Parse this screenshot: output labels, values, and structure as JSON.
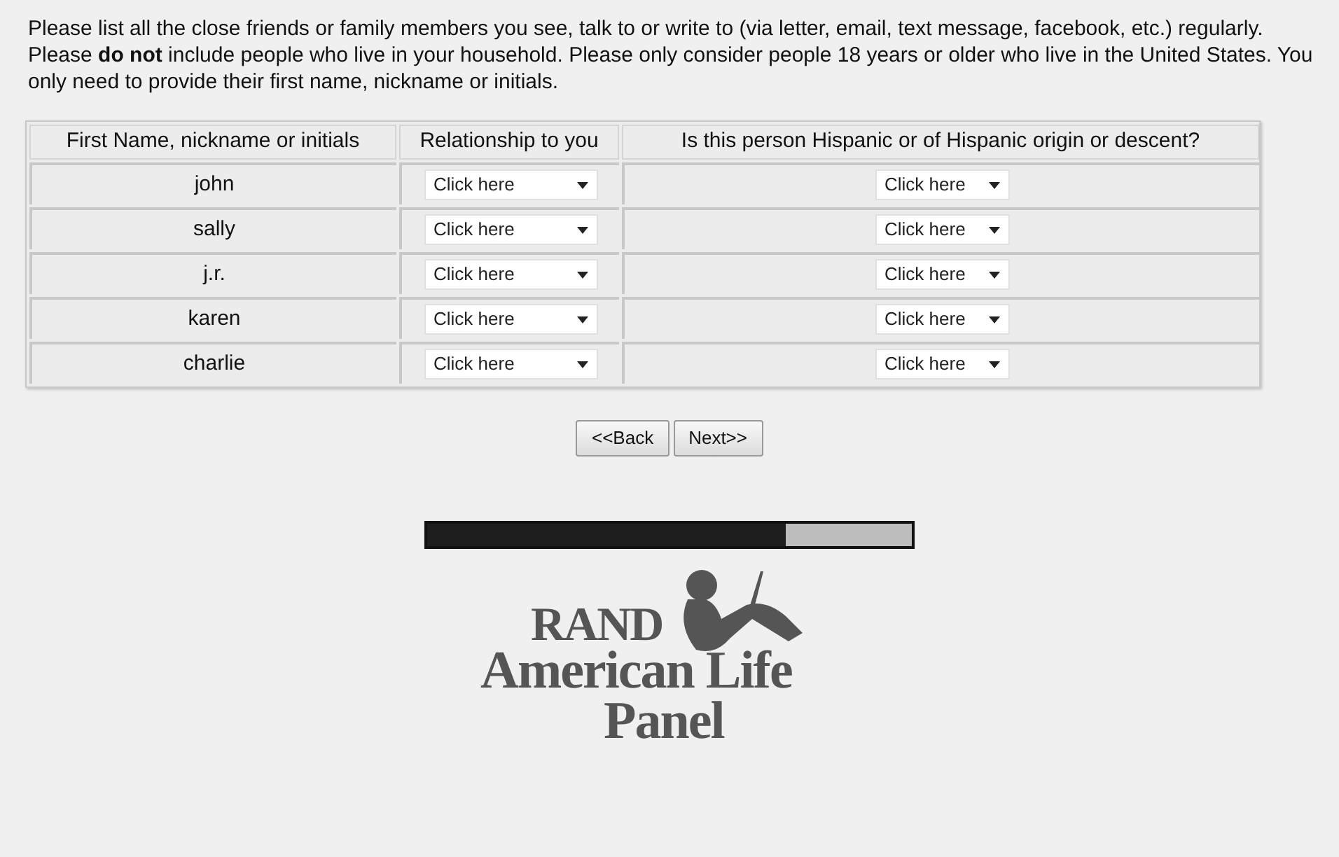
{
  "instructions": "Please list all the close friends or family members you see, talk to or write to (via letter, email, text message, facebook, etc.) regularly. Please **do not** include people who live in your household. Please only consider people 18 years or older who live in the United States. You only need to provide their first name, nickname or initials.",
  "table": {
    "columns": [
      "First Name, nickname or initials",
      "Relationship to you",
      "Is this person Hispanic or of Hispanic origin or descent?"
    ],
    "rows": [
      {
        "name": "john",
        "relationship": "Click here",
        "hispanic": "Click here"
      },
      {
        "name": "sally",
        "relationship": "Click here",
        "hispanic": "Click here"
      },
      {
        "name": "j.r.",
        "relationship": "Click here",
        "hispanic": "Click here"
      },
      {
        "name": "karen",
        "relationship": "Click here",
        "hispanic": "Click here"
      },
      {
        "name": "charlie",
        "relationship": "Click here",
        "hispanic": "Click here"
      }
    ]
  },
  "buttons": [
    "<<Back",
    "Next>>"
  ],
  "progress": {
    "level": 0.74
  },
  "logo": {
    "line_1": "RAND",
    "line_2": "American Life",
    "line_3": "Panel"
  }
}
